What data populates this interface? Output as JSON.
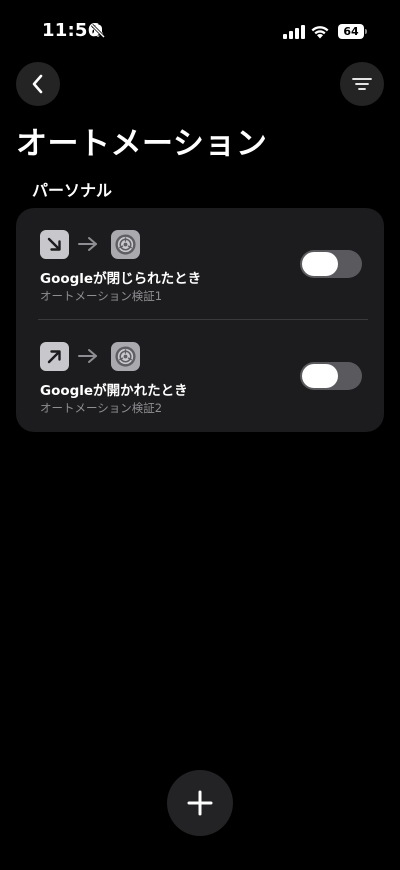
{
  "status_bar": {
    "time": "11:56",
    "battery": "64",
    "icons": [
      "bell-slash-icon",
      "signal-icon",
      "wifi-icon",
      "battery-icon"
    ]
  },
  "header": {
    "title": "オートメーション",
    "back_icon": "chevron-left-icon",
    "filter_icon": "filter-icon"
  },
  "section": {
    "title": "パーソナル"
  },
  "automations": [
    {
      "title": "Googleが閉じられたとき",
      "subtitle": "オートメーション検証1",
      "trigger_icon": "arrow-down-right-icon",
      "action_icon": "settings-gear-icon",
      "enabled": false
    },
    {
      "title": "Googleが開かれたとき",
      "subtitle": "オートメーション検証2",
      "trigger_icon": "arrow-up-right-icon",
      "action_icon": "settings-gear-icon",
      "enabled": false
    }
  ],
  "fab": {
    "icon": "plus-icon"
  },
  "colors": {
    "background": "#000000",
    "card": "#1c1c1e",
    "toggle_track": "#5a5a5e",
    "secondary_text": "#8e8e93"
  }
}
